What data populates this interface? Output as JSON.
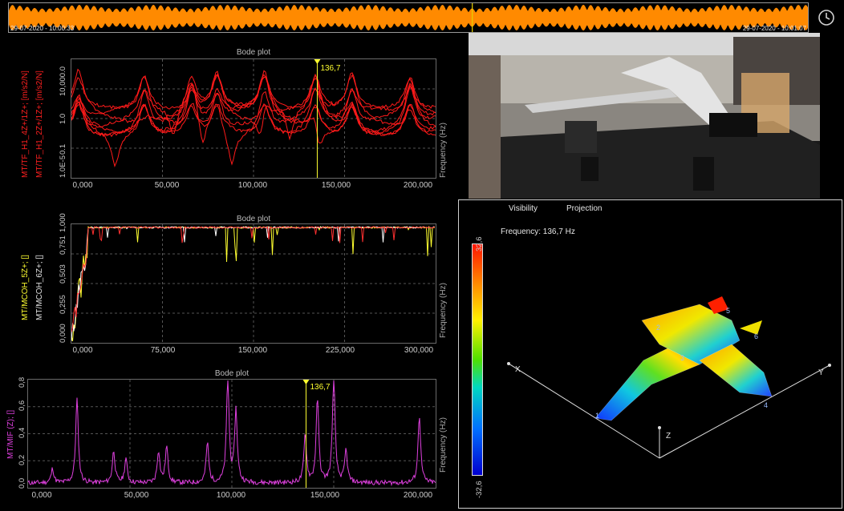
{
  "timeline": {
    "start_label": "29-07-2020 - 10:00:33",
    "end_label": "29-07-2020 - 10:01:07",
    "wave_color": "#ff8a00",
    "cursor_color": "#e6d200",
    "cursor_fraction": 0.58
  },
  "icons": {
    "history": "clock-icon"
  },
  "bode1": {
    "title": "Bode plot",
    "ylabels": [
      "MT/TF_H1_4Z+/1Z+; [m/s2/N]",
      "MT/TF_H1_2Z+/1Z+; [m/s2/N]"
    ],
    "ylabel_color": "#ff2020",
    "right_label": "Frequency (Hz)",
    "yticks": [
      "1.0E-5",
      "0.1",
      "1.0",
      "10,000.0"
    ],
    "xticks": [
      "0,000",
      "50,000",
      "100,000",
      "150,000",
      "200,000"
    ],
    "cursor_label": "136,7",
    "line_color": "#ff1a1a"
  },
  "bode2": {
    "title": "Bode plot",
    "ylabels": [
      "MT/MCOH_5Z+; []",
      "MT/MCOH_6Z+; []"
    ],
    "ylabel_colors": [
      "#ffff30",
      "#e0e0e0"
    ],
    "right_label": "Frequency (Hz)",
    "yticks": [
      "0,000",
      "0,255",
      "0,503",
      "0,751",
      "1,000"
    ],
    "xticks": [
      "0,000",
      "75,000",
      "150,000",
      "225,000",
      "300,000"
    ]
  },
  "bode3": {
    "title": "Bode plot",
    "ylabel": "MT/MIF (Z); []",
    "ylabel_color": "#e040e0",
    "right_label": "Frequency (Hz)",
    "yticks": [
      "0,0",
      "0,2",
      "0,4",
      "0,6",
      "0,8"
    ],
    "xticks": [
      "0,000",
      "50,000",
      "100,000",
      "150,000",
      "200,000"
    ],
    "cursor_label": "136,7",
    "line_color": "#e040e0"
  },
  "mode_view": {
    "menu": [
      "Visibility",
      "Projection"
    ],
    "frequency_text": "Frequency: 136,7 Hz",
    "colorbar_max": "32,6",
    "colorbar_min": "-32,6",
    "axis_labels": [
      "X",
      "Y",
      "Z"
    ],
    "node_labels": [
      "1",
      "2",
      "3",
      "4",
      "5",
      "6"
    ]
  }
}
